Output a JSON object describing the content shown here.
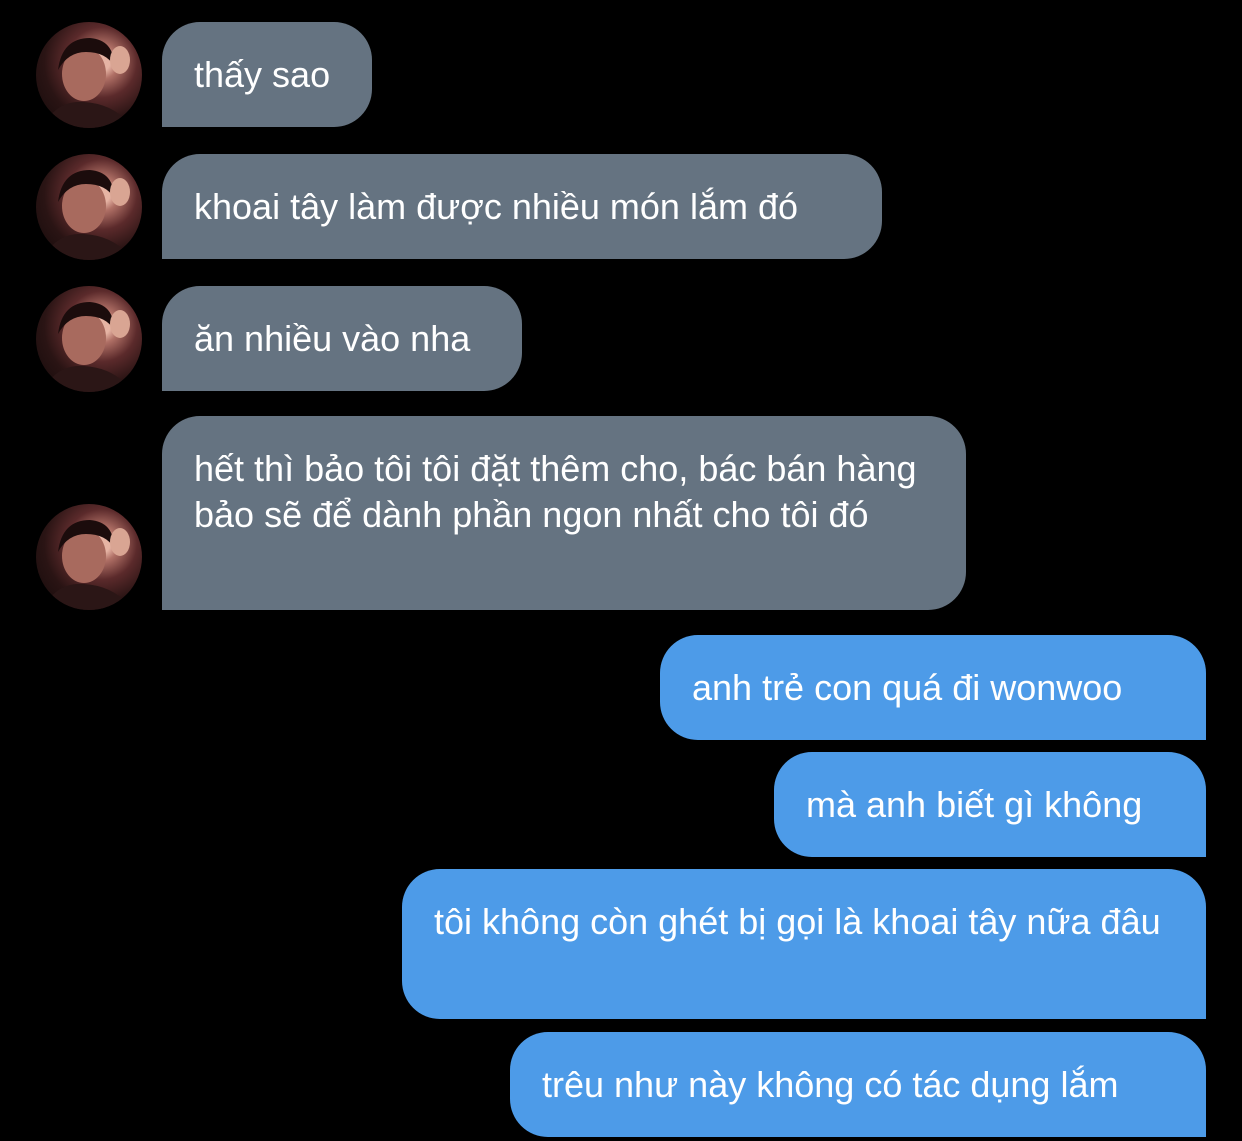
{
  "colors": {
    "background": "#000000",
    "incoming_bubble": "#657381",
    "outgoing_bubble": "#4d9be8",
    "text": "#ffffff"
  },
  "messages": [
    {
      "direction": "incoming",
      "text": "thấy sao",
      "avatar_icon": "contact-avatar"
    },
    {
      "direction": "incoming",
      "text": "khoai tây làm được nhiều món lắm đó",
      "avatar_icon": "contact-avatar"
    },
    {
      "direction": "incoming",
      "text": "ăn nhiều vào nha",
      "avatar_icon": "contact-avatar"
    },
    {
      "direction": "incoming",
      "text": "hết thì bảo tôi tôi đặt thêm cho, bác bán hàng bảo sẽ để dành phần ngon nhất cho tôi đó",
      "avatar_icon": "contact-avatar"
    },
    {
      "direction": "outgoing",
      "text": "anh trẻ con quá đi wonwoo"
    },
    {
      "direction": "outgoing",
      "text": "mà anh biết gì không"
    },
    {
      "direction": "outgoing",
      "text": "tôi không còn ghét bị gọi là khoai tây nữa đâu"
    },
    {
      "direction": "outgoing",
      "text": "trêu như này không có tác dụng lắm"
    }
  ]
}
